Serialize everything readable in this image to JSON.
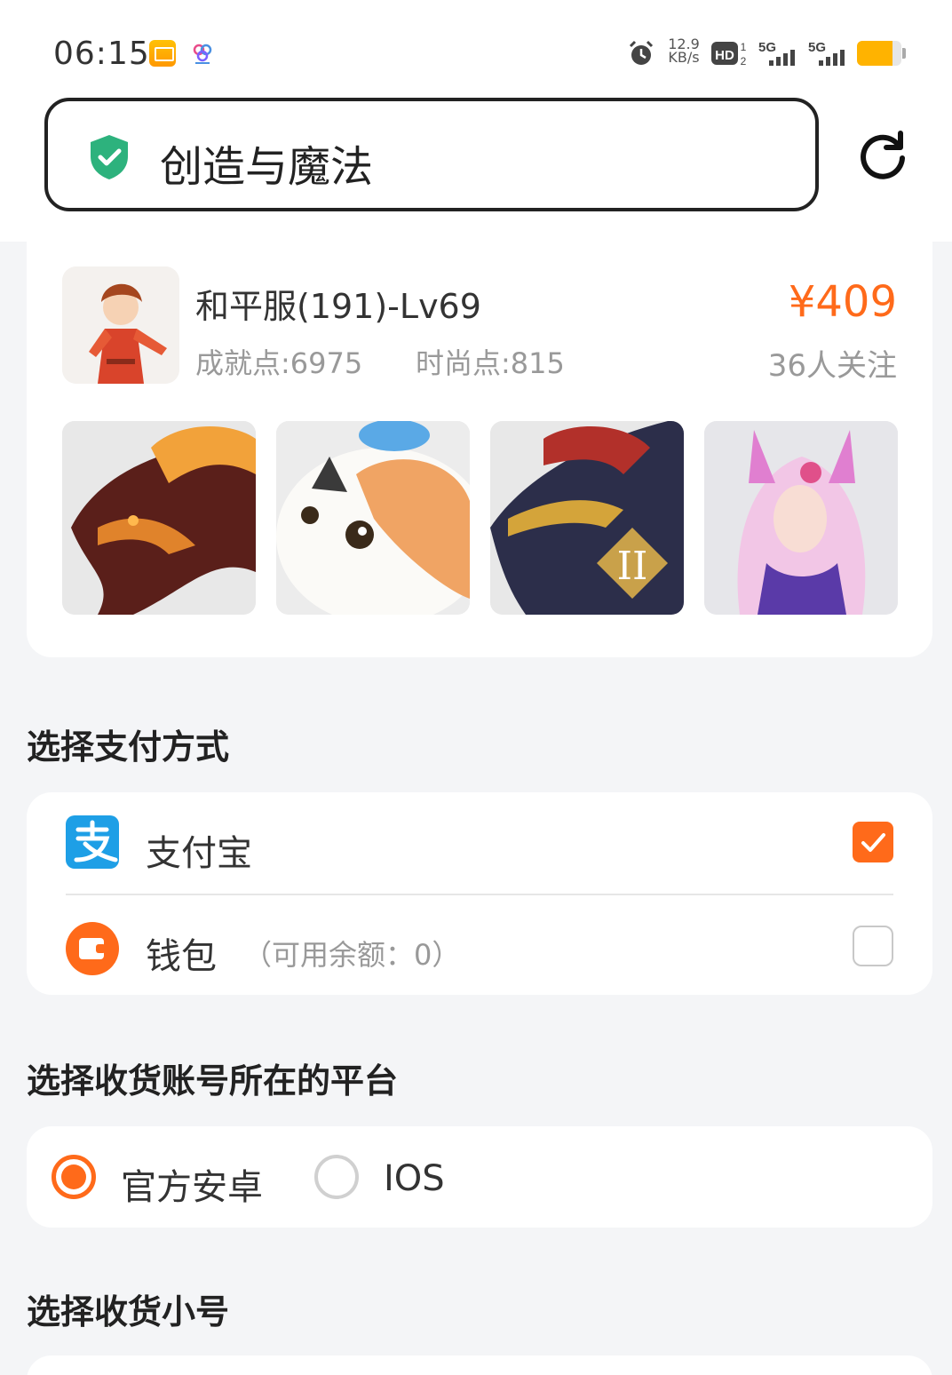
{
  "status_bar": {
    "time": "06:15",
    "net_speed_value": "12.9",
    "net_speed_unit": "KB/s",
    "hd_label": "HD",
    "signal_1": "5G",
    "signal_2": "5G",
    "battery_level": 0.8,
    "battery_color": "#ffb300"
  },
  "search": {
    "value": "创造与魔法",
    "shield_icon": "shield-check-icon",
    "refresh_icon": "refresh-icon"
  },
  "product": {
    "title": "和平服(191)-Lv69",
    "achievement": "成就点:6975",
    "fashion": "时尚点:815",
    "price": "¥409",
    "followers": "36人关注",
    "thumbnails": [
      "dragon-mount",
      "cat-pet",
      "dragon-mount-2",
      "fox-character"
    ]
  },
  "payment": {
    "section_title": "选择支付方式",
    "options": [
      {
        "label": "支付宝",
        "icon": "alipay-icon",
        "selected": true
      },
      {
        "label": "钱包",
        "extra": "（可用余额：0）",
        "icon": "wallet-icon",
        "selected": false
      }
    ]
  },
  "platform": {
    "section_title": "选择收货账号所在的平台",
    "options": [
      {
        "label": "官方安卓",
        "selected": true
      },
      {
        "label": "IOS",
        "selected": false
      }
    ]
  },
  "sub_account": {
    "section_title": "选择收货小号"
  },
  "colors": {
    "accent": "#ff6a1a",
    "alipay": "#1e9fe6",
    "shield": "#2db27d",
    "page_bg": "#f4f5f7"
  }
}
